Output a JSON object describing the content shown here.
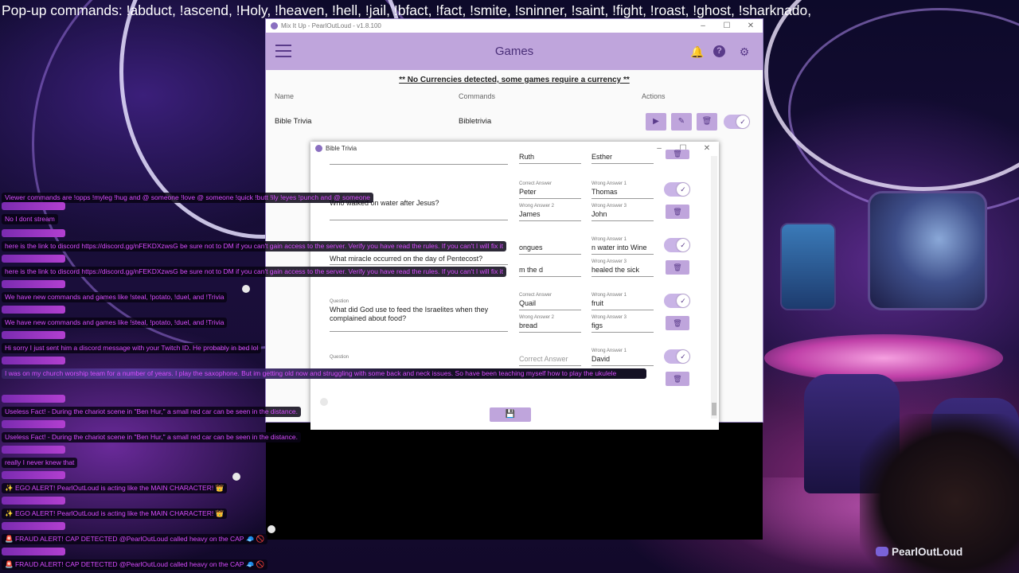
{
  "banner": {
    "text": "Pop-up commands: !abduct, !ascend, !Holy, !heaven, !hell,  !jail, !bfact, !fact, !smite, !sninner, !saint, !fight, !roast, !ghost, !sharknado,"
  },
  "app": {
    "window_title": "Mix It Up - PearlOutLoud - v1.8.100",
    "page_title": "Games",
    "currency_notice": "** No Currencies detected, some games require a currency **",
    "columns": {
      "name": "Name",
      "commands": "Commands",
      "actions": "Actions"
    },
    "games": [
      {
        "name": "Bible Trivia",
        "command": "Bibletrivia",
        "enabled": true
      }
    ]
  },
  "dialog": {
    "title": "Bible Trivia",
    "labels": {
      "question": "Question",
      "correct": "Correct Answer",
      "wrong1": "Wrong Answer 1",
      "wrong2": "Wrong Answer 2",
      "wrong3": "Wrong Answer 3"
    },
    "questions": [
      {
        "text": "",
        "correct": "Ruth",
        "wrong1": "Esther",
        "wrong2": "",
        "wrong3": "",
        "partial": true
      },
      {
        "text": "Who walked on water after Jesus?",
        "correct": "Peter",
        "wrong1": "Thomas",
        "wrong2": "James",
        "wrong3": "John",
        "enabled": true
      },
      {
        "text": "What miracle occurred on the day of Pentecost?",
        "correct": "ongues",
        "wrong1": "n water into Wine",
        "wrong2": "m the d",
        "wrong3": "healed the sick",
        "enabled": true
      },
      {
        "text": "What did God use to feed the Israelites when they complained about food?",
        "correct": "Quail",
        "wrong1": "fruit",
        "wrong2": "bread",
        "wrong3": "figs",
        "enabled": true
      },
      {
        "text": "",
        "correct": "",
        "wrong1": "David",
        "wrong2": "",
        "wrong3": "",
        "enabled": true
      }
    ]
  },
  "chat": [
    {
      "msg": "Viewer commands are !opps !myleg !hug and @ someone !love @ someone !quick !butt !ily !eyes !punch and @ someone"
    },
    {
      "msg": "No I dont stream"
    },
    {
      "msg": "here is the link to discord https://discord.gg/nFEKDXzwsG be sure not to DM if you can't gain access to the server. Verify you have read the rules. If you can't I will fix it"
    },
    {
      "msg": "here is the link to discord https://discord.gg/nFEKDXzwsG be sure not to DM if you can't gain access to the server. Verify you have read the rules. If you can't I will fix it"
    },
    {
      "msg": "We have new commands and games like !steal, !potato, !duel, and !Trivia"
    },
    {
      "msg": "We have new commands and games like !steal, !potato, !duel, and !Trivia"
    },
    {
      "msg": "Hi sorry I just sent him a discord message with your Twitch ID. He probably in bed lol"
    },
    {
      "msg": "I was on my church worship team for a number of years. I play the saxophone. But im getting old now and struggling with some back and neck issues. So have been teaching myself how to play the ukulele"
    },
    {
      "msg": "Useless Fact! - During the chariot scene in \"Ben Hur,\" a small red car can be seen in the distance."
    },
    {
      "msg": "Useless Fact! - During the chariot scene in \"Ben Hur,\" a small red car can be seen in the distance."
    },
    {
      "msg": "really I never knew that"
    },
    {
      "msg": "✨ EGO ALERT! PearlOutLoud is acting like the MAIN CHARACTER! 👑"
    },
    {
      "msg": "✨ EGO ALERT! PearlOutLoud is acting like the MAIN CHARACTER! 👑"
    },
    {
      "msg": "🚨 FRAUD ALERT! CAP DETECTED @PearlOutLoud called heavy on the CAP 🧢 🚫"
    },
    {
      "msg": "🚨 FRAUD ALERT! CAP DETECTED @PearlOutLoud called heavy on the CAP 🧢 🚫"
    }
  ],
  "streamer": {
    "name": "PearlOutLoud"
  },
  "colors": {
    "accent": "#bfa5dc",
    "chat_text": "#d84cff"
  }
}
